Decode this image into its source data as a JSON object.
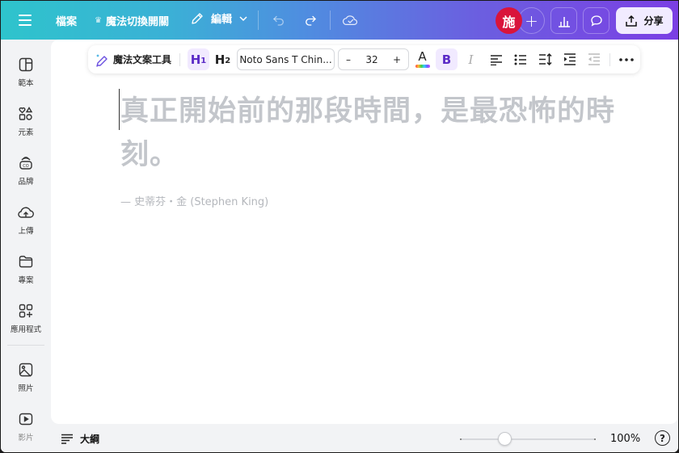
{
  "topbar": {
    "menu_icon": "hamburger-menu-icon",
    "file_label": "檔案",
    "magic_switch_label": "魔法切換開關",
    "magic_switch_icon": "crown-icon",
    "edit_label": "編輯",
    "edit_icon": "pencil-icon",
    "undo_icon": "undo-icon",
    "redo_icon": "redo-icon",
    "save_status_icon": "cloud-check-icon",
    "avatar_initial": "施",
    "add_collaborator_icon": "plus-icon",
    "add_collaborator_label": "+",
    "insights_icon": "bar-chart-icon",
    "comment_icon": "speech-bubble-icon",
    "share_label": "分享",
    "share_icon": "upload-icon",
    "colors": {
      "avatar": "#d9143b",
      "gradient_start": "#2ec4cc",
      "gradient_end": "#7b3fe4"
    }
  },
  "sidebar": {
    "items": [
      {
        "label": "範本",
        "icon": "template-icon"
      },
      {
        "label": "元素",
        "icon": "elements-icon"
      },
      {
        "label": "品牌",
        "icon": "brand-icon"
      },
      {
        "label": "上傳",
        "icon": "cloud-upload-icon"
      },
      {
        "label": "專案",
        "icon": "folder-icon"
      },
      {
        "label": "應用程式",
        "icon": "apps-icon"
      },
      {
        "label": "照片",
        "icon": "photo-icon"
      },
      {
        "label": "影片",
        "icon": "video-icon"
      }
    ]
  },
  "text_toolbar": {
    "magic_write_label": "魔法文案工具",
    "magic_write_icon": "magic-pen-icon",
    "h1_label": "H",
    "h1_sub": "1",
    "h2_label": "H",
    "h2_sub": "2",
    "font_family": "Noto Sans T Chin...",
    "font_size": "32",
    "decrease_label": "–",
    "increase_label": "+",
    "text_color_label": "A",
    "bold_label": "B",
    "italic_label": "I",
    "align_icon": "align-left-icon",
    "list_icon": "bullet-list-icon",
    "spacing_icon": "line-spacing-icon",
    "indent_icon": "indent-icon",
    "outdent_icon": "outdent-icon",
    "more_icon": "more-horizontal-icon",
    "accent_color": "#5b2bc7"
  },
  "canvas": {
    "quote": "真正開始前的那段時間，是最恐怖的時刻。",
    "author": "— 史蒂芬・金 (Stephen King)"
  },
  "bottombar": {
    "outline_label": "大綱",
    "outline_icon": "outline-icon",
    "zoom_value": 100,
    "zoom_label": "100%",
    "zoom_slider_fraction": 0.33,
    "help_label": "?"
  }
}
